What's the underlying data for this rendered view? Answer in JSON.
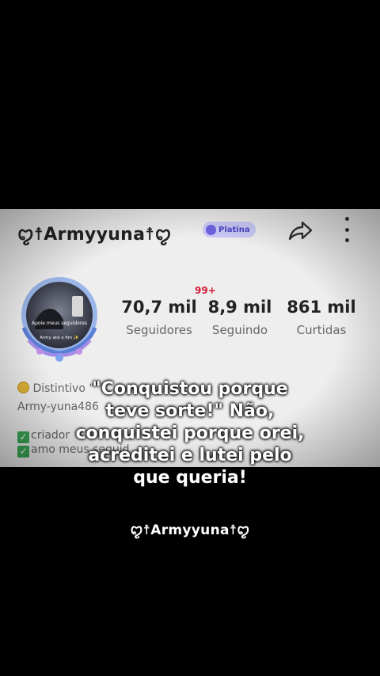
{
  "profile": {
    "username": "ꨄ☨Armyyuna☨ꨄ",
    "badge_label": "Platina",
    "notification_count": "99+",
    "stats": [
      {
        "value": "70,7 mil",
        "label": "Seguidores"
      },
      {
        "value": "8,9 mil",
        "label": "Seguindo"
      },
      {
        "value": "861 mil",
        "label": "Curtidas"
      }
    ],
    "bio": {
      "line1": "Distintivo \"",
      "line2": "Army-yuna486",
      "line3": "criador",
      "line4": "amo meus seguid"
    },
    "avatar_text_top": "Apoie meus seguidores",
    "avatar_text_bottom": "Army até o fim ✨"
  },
  "overlay_text": "\"Conquistou porque\nteve sorte!\" Não,\nconquistei porque orei,\nacreditei e lutei pelo\nque queria!",
  "signature": "ꨄ☨Armyyuna☨ꨄ",
  "colors": {
    "badge_bg": "#c9c9f5",
    "badge_text": "#4b45c6",
    "notification": "#d21c3a",
    "check": "#3aa655"
  }
}
